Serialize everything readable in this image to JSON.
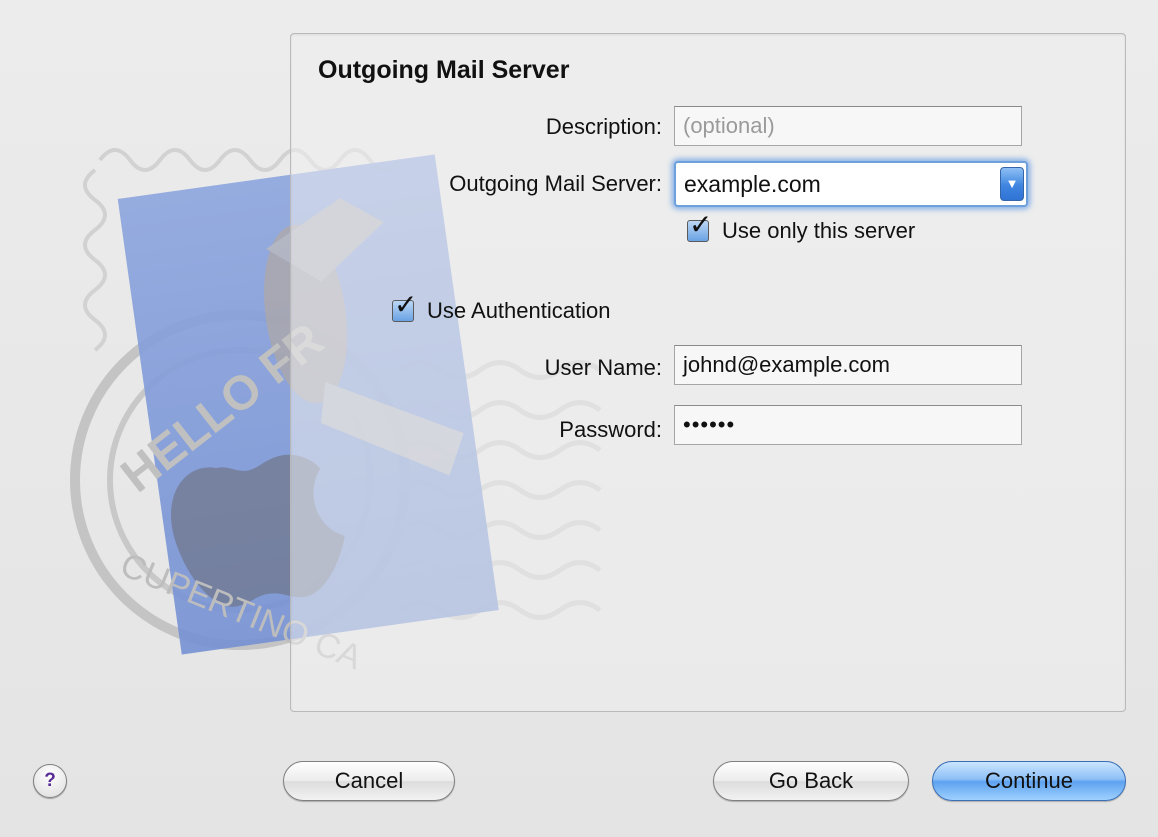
{
  "panel": {
    "title": "Outgoing Mail Server"
  },
  "form": {
    "description_label": "Description:",
    "description_placeholder": "(optional)",
    "server_label": "Outgoing Mail Server:",
    "server_value": "example.com",
    "use_only_label": "Use only this server",
    "use_only_checked": true,
    "use_auth_label": "Use Authentication",
    "use_auth_checked": true,
    "username_label": "User Name:",
    "username_value": "johnd@example.com",
    "password_label": "Password:",
    "password_value": "••••••"
  },
  "stamp": {
    "text_top": "HELLO FR",
    "text_bottom": "CUPERTINO CA"
  },
  "buttons": {
    "help": "?",
    "cancel": "Cancel",
    "go_back": "Go Back",
    "continue": "Continue"
  },
  "icons": {
    "help": "help-icon",
    "dropdown": "chevron-down-icon",
    "checkbox": "checkmark-icon"
  },
  "colors": {
    "accent": "#5ea2ef",
    "focus_ring": "#6ea0dc"
  }
}
